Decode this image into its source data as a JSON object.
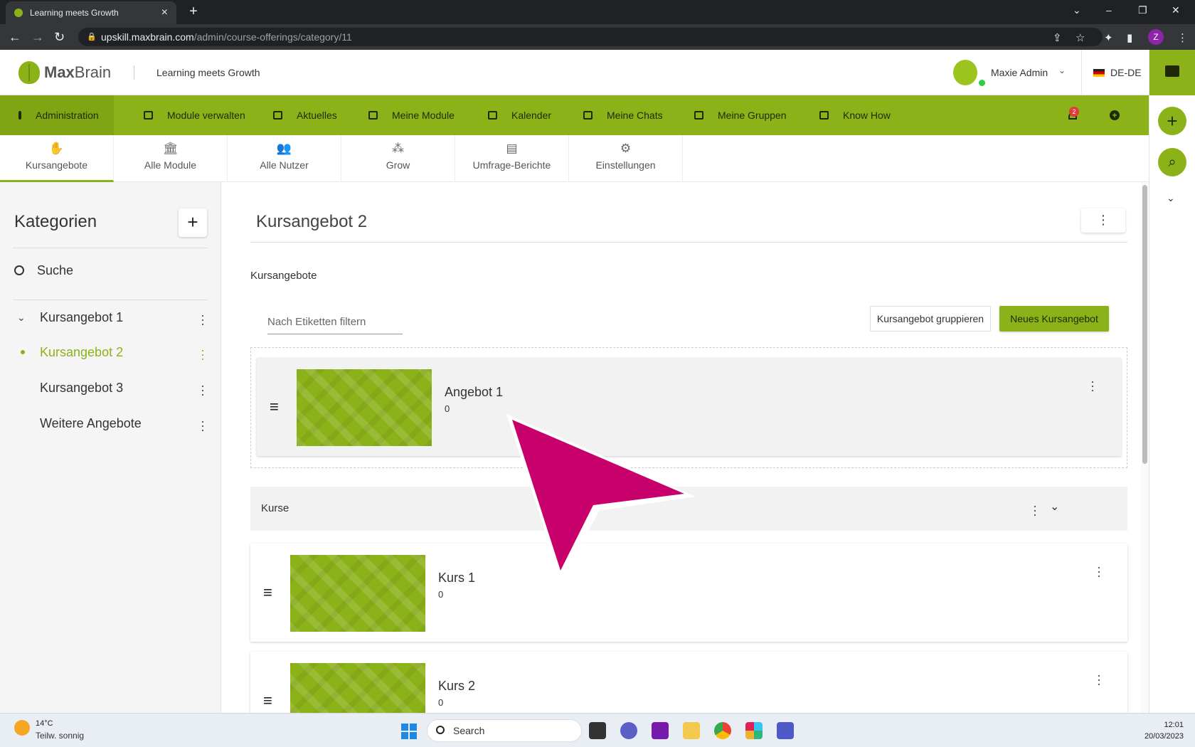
{
  "browser": {
    "tab_title": "Learning meets Growth",
    "url_host": "upskill.maxbrain.com",
    "url_path": "/admin/course-offerings/category/11",
    "profile_initial": "Z"
  },
  "header": {
    "logo_bold": "Max",
    "logo_light": "Brain",
    "tagline": "Learning meets Growth",
    "user_name": "Maxie Admin",
    "language": "DE-DE"
  },
  "nav": {
    "items": [
      {
        "label": "Administration"
      },
      {
        "label": "Module verwalten"
      },
      {
        "label": "Aktuelles"
      },
      {
        "label": "Meine Module"
      },
      {
        "label": "Kalender"
      },
      {
        "label": "Meine Chats"
      },
      {
        "label": "Meine Gruppen"
      },
      {
        "label": "Know How"
      }
    ],
    "notification_count": "2"
  },
  "subtabs": [
    {
      "label": "Kursangebote",
      "icon": "hand-book-icon"
    },
    {
      "label": "Alle Module",
      "icon": "institution-icon"
    },
    {
      "label": "Alle Nutzer",
      "icon": "users-icon"
    },
    {
      "label": "Grow",
      "icon": "group-icon"
    },
    {
      "label": "Umfrage-Berichte",
      "icon": "report-icon"
    },
    {
      "label": "Einstellungen",
      "icon": "gears-icon"
    }
  ],
  "sidebar": {
    "title": "Kategorien",
    "search_label": "Suche",
    "items": [
      {
        "label": "Kursangebot 1"
      },
      {
        "label": "Kursangebot 2"
      },
      {
        "label": "Kursangebot 3"
      },
      {
        "label": "Weitere Angebote"
      }
    ]
  },
  "main": {
    "title": "Kursangebot 2",
    "section_label": "Kursangebote",
    "filter_placeholder": "Nach Etiketten filtern",
    "group_button": "Kursangebot gruppieren",
    "new_button": "Neues Kursangebot",
    "offer": {
      "title": "Angebot 1",
      "value": "0"
    },
    "group_title": "Kurse",
    "courses": [
      {
        "title": "Kurs 1",
        "value": "0"
      },
      {
        "title": "Kurs 2",
        "value": "0"
      }
    ]
  },
  "colors": {
    "brand_green": "#8cb21a",
    "pointer_magenta": "#c8006b"
  },
  "taskbar": {
    "temperature": "14°C",
    "weather": "Teilw. sonnig",
    "search_label": "Search",
    "time": "12:01",
    "date": "20/03/2023"
  }
}
